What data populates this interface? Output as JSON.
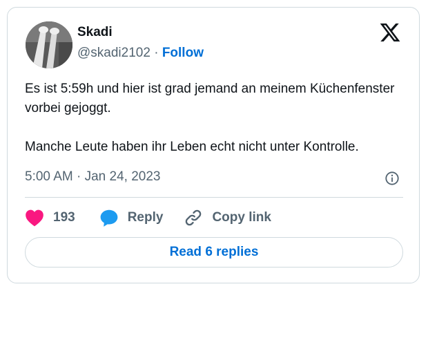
{
  "author": {
    "name": "Skadi",
    "handle": "@skadi2102",
    "separator": "·",
    "follow_label": "Follow"
  },
  "tweet": {
    "paragraphs": [
      "Es ist 5:59h und hier ist grad jemand an meinem Küchenfenster vorbei gejoggt.",
      "Manche Leute haben ihr Leben echt nicht unter Kontrolle."
    ],
    "timestamp": "5:00 AM · Jan 24, 2023"
  },
  "actions": {
    "like_count": "193",
    "reply_label": "Reply",
    "copy_link_label": "Copy link"
  },
  "read_replies_label": "Read 6 replies",
  "icons": {
    "logo": "x-logo-icon",
    "info": "info-icon",
    "like": "heart-icon",
    "reply": "speech-bubble-icon",
    "copy": "link-icon"
  },
  "colors": {
    "like": "#f91880",
    "reply": "#1d9bf0",
    "link": "#006fd6",
    "muted": "#536471",
    "text": "#0f1419",
    "border": "#cfd9de"
  }
}
